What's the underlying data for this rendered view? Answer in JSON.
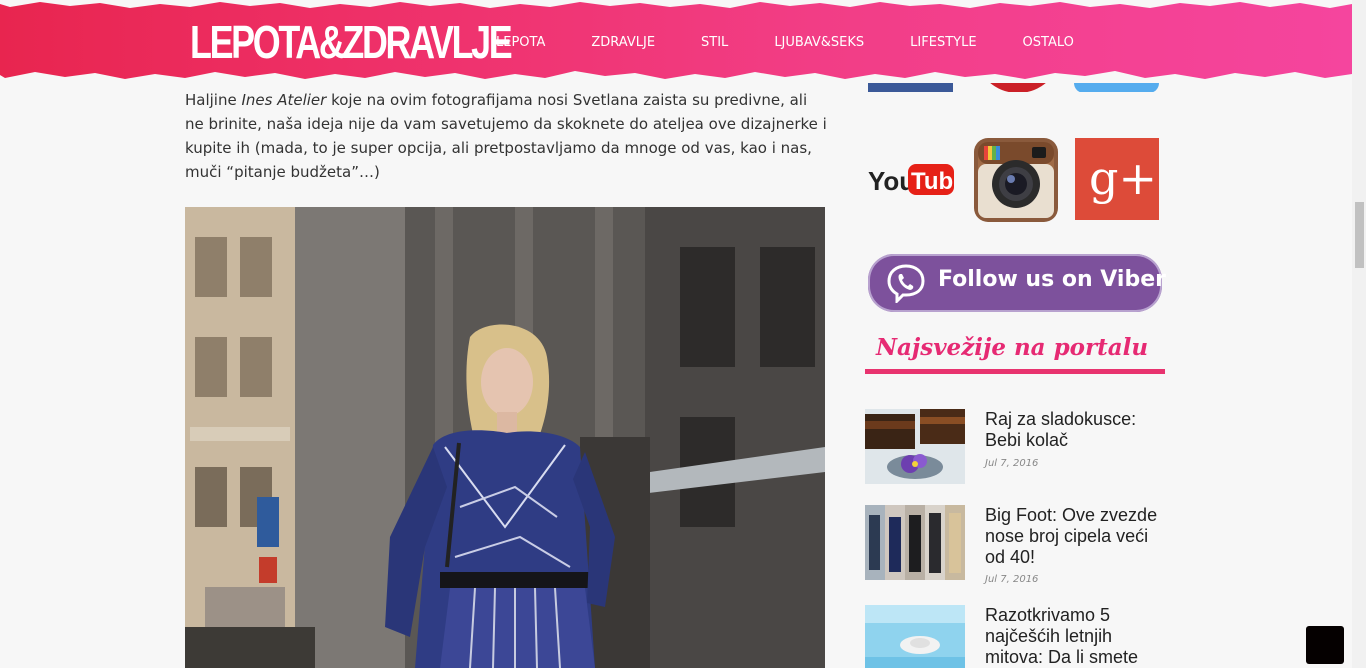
{
  "header": {
    "logo": "LEPOTA&ZDRAVLJE",
    "nav": [
      "LEPOTA",
      "ZDRAVLJE",
      "STIL",
      "LJUBAV&SEKS",
      "LIFESTYLE",
      "OSTALO"
    ],
    "colors": {
      "start": "#e8254f",
      "end": "#f5459e"
    }
  },
  "article": {
    "p_start": "Haljine ",
    "p_brand": "Ines Atelier",
    "p_end": " koje na ovim fotografijama nosi Svetlana zaista su predivne, ali ne brinite, naša ideja nije da vam savetujemo da skoknete do ateljea ove dizajnerke i kupite ih (mada, to je super opcija, ali pretpostavljamo da mnoge od vas, kao i nas, muči “pitanje budžeta”…)"
  },
  "sidebar": {
    "social": {
      "youtube_you": "You",
      "youtube_tube": "Tube",
      "google_plus": "g+"
    },
    "viber_label": "Follow us on Viber",
    "widget_title": "Najsvežije na portalu",
    "posts": [
      {
        "title": "Raj za sladokusce: Bebi kolač",
        "date": "Jul 7, 2016"
      },
      {
        "title": "Big Foot: Ove zvezde nose broj cipela veći od 40!",
        "date": "Jul 7, 2016"
      },
      {
        "title": "Razotkrivamo 5 najčešćih letnjih mitova: Da li smete",
        "date": ""
      }
    ]
  },
  "icons": [
    "facebook-icon",
    "pinterest-icon",
    "twitter-icon",
    "youtube-icon",
    "instagram-icon",
    "google-plus-icon",
    "viber-icon",
    "chat-icon"
  ]
}
